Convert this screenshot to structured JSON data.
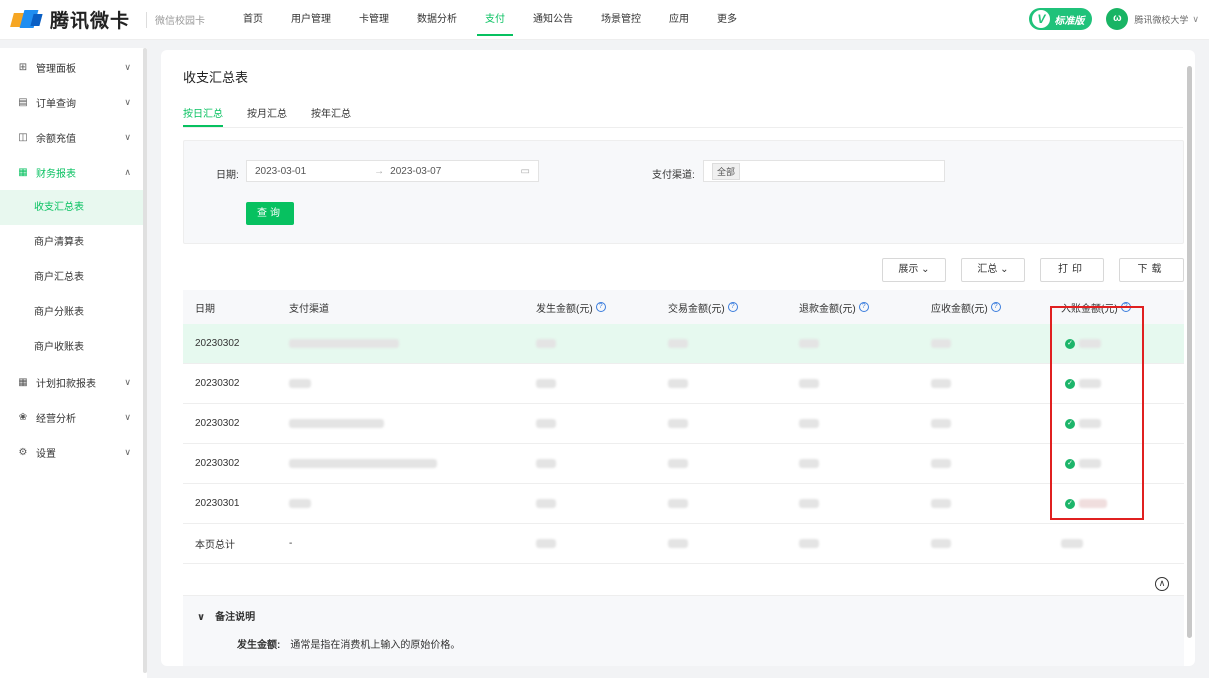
{
  "header": {
    "brand": "腾讯微卡",
    "campus": "微信校园卡",
    "nav": [
      "首页",
      "用户管理",
      "卡管理",
      "数据分析",
      "支付",
      "通知公告",
      "场景管控",
      "应用",
      "更多"
    ],
    "active_nav": "支付",
    "edition_badge": "标准版",
    "badge_letter": "V",
    "avatar_text": "ω",
    "user_name": "腾讯微校大学"
  },
  "sidebar": {
    "items": [
      {
        "label": "管理面板",
        "icon": "grid-icon"
      },
      {
        "label": "订单查询",
        "icon": "list-icon"
      },
      {
        "label": "余额充值",
        "icon": "wallet-icon"
      },
      {
        "label": "财务报表",
        "icon": "table-icon"
      },
      {
        "label": "计划扣款报表",
        "icon": "table-icon"
      },
      {
        "label": "经营分析",
        "icon": "chart-icon"
      },
      {
        "label": "设置",
        "icon": "gear-icon"
      }
    ],
    "sub_items": [
      "收支汇总表",
      "商户清算表",
      "商户汇总表",
      "商户分账表",
      "商户收账表"
    ]
  },
  "page": {
    "title": "收支汇总表",
    "tabs": [
      "按日汇总",
      "按月汇总",
      "按年汇总"
    ]
  },
  "filter": {
    "date_label": "日期:",
    "date_start": "2023-03-01",
    "date_end": "2023-03-07",
    "date_sep": "→",
    "channel_label": "支付渠道:",
    "channel_value": "全部",
    "query_button": "查询"
  },
  "toolbar": {
    "display": "展示 ⌄",
    "summary": "汇总 ⌄",
    "print": "打印",
    "download": "下载"
  },
  "table": {
    "columns": [
      "日期",
      "支付渠道",
      "发生金额(元)",
      "交易金额(元)",
      "退款金额(元)",
      "应收金额(元)",
      "入账金额(元)"
    ],
    "rows": [
      {
        "date": "20230302"
      },
      {
        "date": "20230302"
      },
      {
        "date": "20230302"
      },
      {
        "date": "20230302"
      },
      {
        "date": "20230301"
      }
    ],
    "total_label": "本页总计",
    "total_channel": "-"
  },
  "notes": {
    "title": "备注说明",
    "term": "发生金额:",
    "text": "通常是指在消费机上输入的原始价格。"
  },
  "colors": {
    "accent": "#07c160",
    "highlight_row": "#e6f9ef",
    "annotation_box": "#e02020"
  }
}
